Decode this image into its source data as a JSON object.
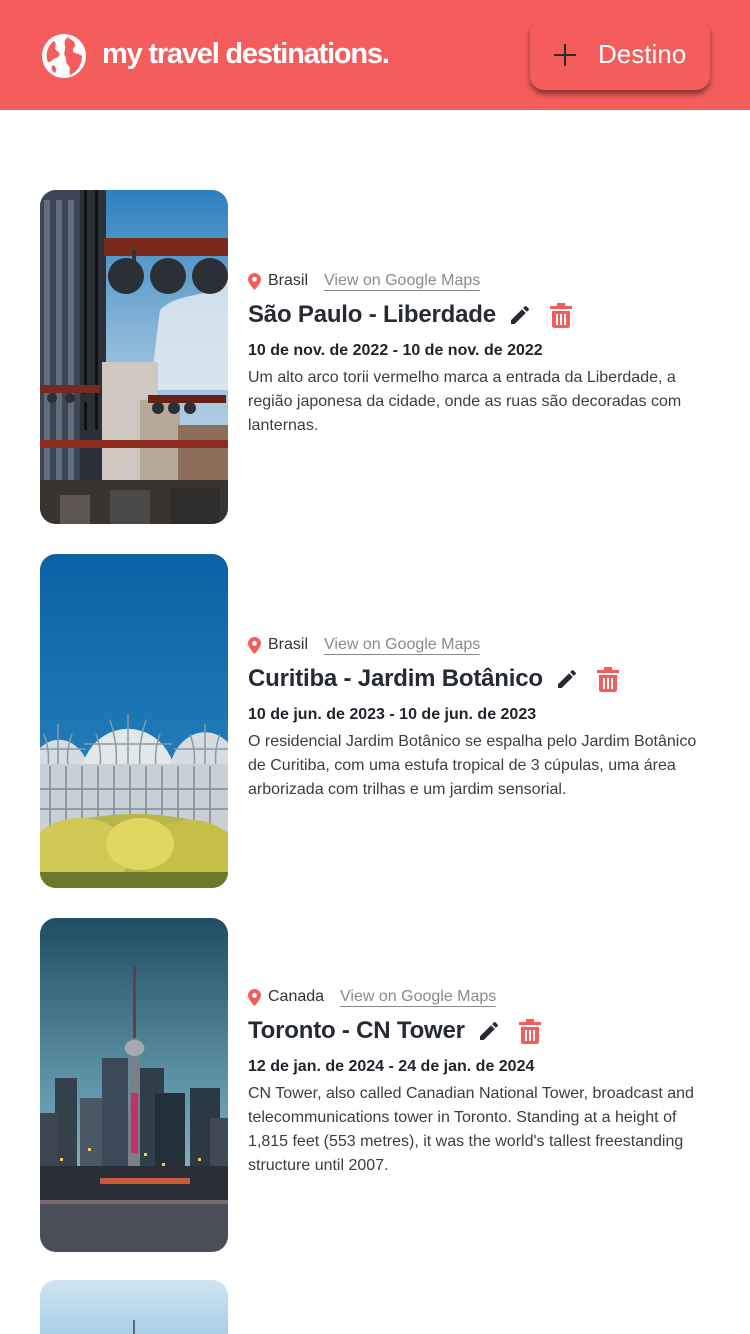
{
  "header": {
    "title": "my travel destinations.",
    "add_button_label": "Destino",
    "brand_color": "#f55d5d",
    "logo_icon": "globe-icon",
    "add_icon": "plus-icon"
  },
  "destinations": [
    {
      "country": "Brasil",
      "maps_link": "View on Google Maps",
      "title": "São Paulo - Liberdade",
      "dates": "10 de nov. de 2022 - 10 de nov. de 2022",
      "description": "Um alto arco torii vermelho marca a entrada da Liberdade, a região japonesa da cidade, onde as ruas são decoradas com lanternas."
    },
    {
      "country": "Brasil",
      "maps_link": "View on Google Maps",
      "title": "Curitiba - Jardim Botânico",
      "dates": "10 de jun. de 2023 - 10 de jun. de 2023",
      "description": "O residencial Jardim Botânico se espalha pelo Jardim Botânico de Curitiba, com uma estufa tropical de 3 cúpulas, uma área arborizada com trilhas e um jardim sensorial."
    },
    {
      "country": "Canada",
      "maps_link": "View on Google Maps",
      "title": "Toronto - CN Tower",
      "dates": "12 de jan. de 2024 - 24 de jan. de 2024",
      "description": "CN Tower, also called Canadian National Tower, broadcast and telecommunications tower in Toronto. Standing at a height of 1,815 feet (553 metres), it was the world's tallest freestanding structure until 2007."
    }
  ],
  "icons": {
    "location": "map-pin-icon",
    "edit": "pencil-icon",
    "delete": "trash-icon"
  }
}
